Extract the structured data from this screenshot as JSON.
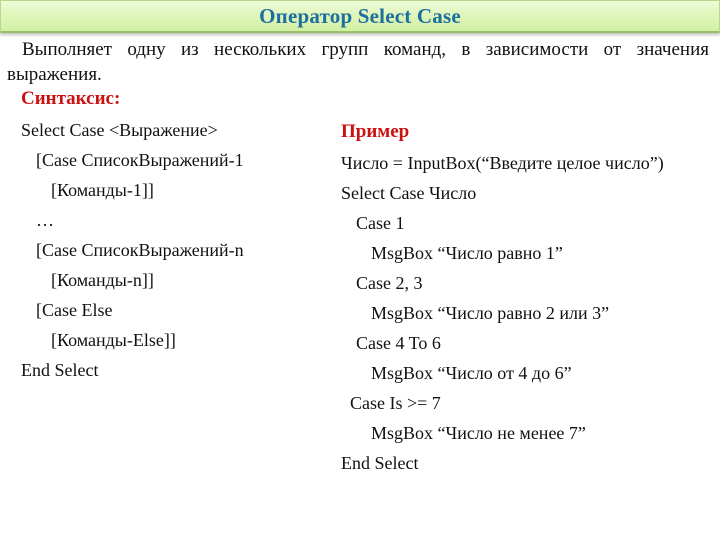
{
  "header": {
    "title": "Оператор Select Case"
  },
  "intro": {
    "line1": "Выполняет одну из нескольких групп команд, в зависимости от значения",
    "line2": "выражения."
  },
  "syntax": {
    "heading": "Синтаксис:",
    "lines": [
      {
        "indent": 0,
        "text": "Select Case <Выражение>"
      },
      {
        "indent": 1,
        "text": "[Case СписокВыражений-1"
      },
      {
        "indent": 2,
        "text": "[Команды-1]]"
      },
      {
        "indent": 1,
        "text": "…"
      },
      {
        "indent": 1,
        "text": "[Case СписокВыражений-n"
      },
      {
        "indent": 2,
        "text": "[Команды-n]]"
      },
      {
        "indent": 1,
        "text": "[Case Else"
      },
      {
        "indent": 2,
        "text": "[Команды-Else]]"
      },
      {
        "indent": 0,
        "text": "End Select"
      }
    ]
  },
  "example": {
    "heading": "Пример",
    "lines": [
      {
        "indent": 0,
        "text": "Число = InputBox(“Введите целое число”)"
      },
      {
        "indent": 0,
        "text": "Select Case Число"
      },
      {
        "indent": 1,
        "text": "Case 1"
      },
      {
        "indent": 2,
        "text": "MsgBox “Число равно 1”"
      },
      {
        "indent": 1,
        "text": "Case 2, 3"
      },
      {
        "indent": 2,
        "text": "MsgBox “Число равно 2 или 3”"
      },
      {
        "indent": 1,
        "text": "Case 4 To 6"
      },
      {
        "indent": 2,
        "text": "MsgBox “Число от 4 до 6”"
      },
      {
        "indent": "h",
        "text": "Case Is >= 7"
      },
      {
        "indent": 2,
        "text": "MsgBox “Число не менее 7”"
      },
      {
        "indent": 0,
        "text": "End Select"
      }
    ]
  }
}
